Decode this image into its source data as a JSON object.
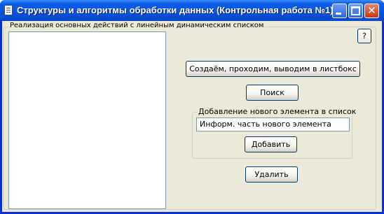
{
  "window": {
    "title": "Структуры и алгоритмы обработки данных (Контрольная работа №1)",
    "icon": "document-icon",
    "controls": {
      "minimize": "minimize-icon",
      "maximize": "maximize-icon",
      "close": "close-icon",
      "close_glyph": "✕"
    }
  },
  "main_group": {
    "legend": "Реализация основных действий с линейным динамическим списком",
    "listbox_items": []
  },
  "help_button": {
    "label": "?"
  },
  "buttons": {
    "create": "Создаём, проходим, выводим в листбокс",
    "search": "Поиск",
    "add": "Добавить",
    "delete": "Удалить"
  },
  "add_group": {
    "legend": "Добавление нового элемента в список",
    "input_value": "Информ. часть нового элемента"
  }
}
